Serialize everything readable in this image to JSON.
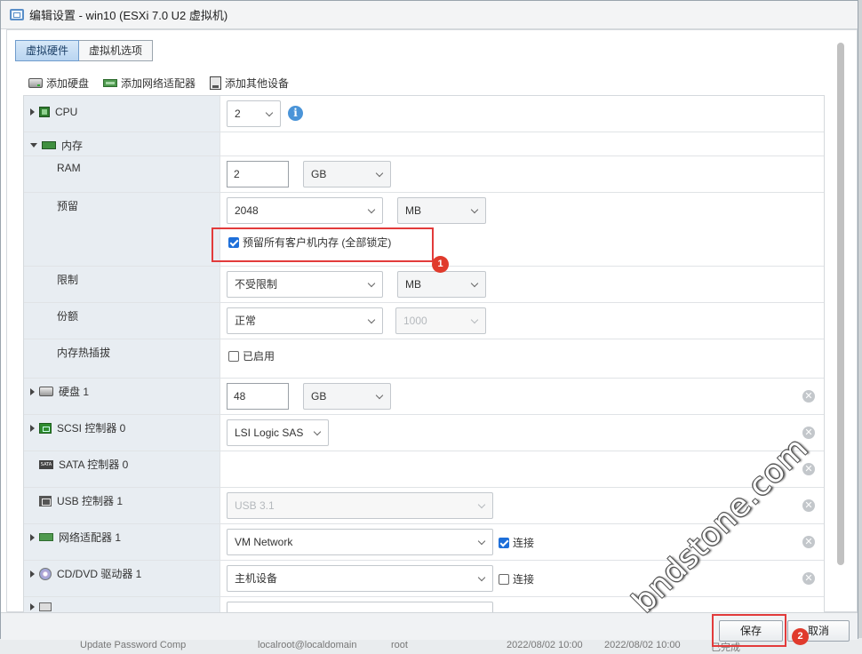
{
  "window": {
    "title": "编辑设置 - win10 (ESXi 7.0 U2 虚拟机)"
  },
  "tabs": [
    {
      "label": "虚拟硬件",
      "active": true
    },
    {
      "label": "虚拟机选项",
      "active": false
    }
  ],
  "toolbar": {
    "add_disk": "添加硬盘",
    "add_nic": "添加网络适配器",
    "add_other": "添加其他设备"
  },
  "hardware": {
    "cpu": {
      "label": "CPU",
      "value": "2",
      "icon": "cpu-icon"
    },
    "memory": {
      "label": "内存",
      "ram_label": "RAM",
      "ram_value": "2",
      "ram_unit": "GB",
      "reservation_label": "预留",
      "reservation_value": "2048",
      "reservation_unit": "MB",
      "reserve_all_label": "预留所有客户机内存 (全部锁定)",
      "reserve_all_checked": true,
      "limit_label": "限制",
      "limit_value": "不受限制",
      "limit_unit": "MB",
      "shares_label": "份额",
      "shares_value": "正常",
      "shares_number": "1000",
      "hotplug_label": "内存热插拔",
      "hotplug_option": "已启用",
      "hotplug_checked": false
    },
    "hard_disk": {
      "label": "硬盘 1",
      "value": "48",
      "unit": "GB"
    },
    "scsi": {
      "label": "SCSI 控制器 0",
      "value": "LSI Logic SAS"
    },
    "sata": {
      "label": "SATA 控制器 0",
      "icon_text": "SATA"
    },
    "usb": {
      "label": "USB 控制器 1",
      "value": "USB 3.1"
    },
    "nic": {
      "label": "网络适配器 1",
      "value": "VM Network",
      "connect_label": "连接",
      "connected": true
    },
    "cdrom": {
      "label": "CD/DVD 驱动器 1",
      "value": "主机设备",
      "connect_label": "连接",
      "connected": false
    }
  },
  "footer": {
    "save": "保存",
    "cancel": "取消"
  },
  "annotations": {
    "badge_1": "1",
    "badge_2": "2"
  },
  "watermark": "bndstone.com",
  "background_strip": {
    "a": "Update Password Comp",
    "b": "localroot@localdomain",
    "c": "root",
    "d": "2022/08/02 10:00",
    "e": "2022/08/02 10:00",
    "f": "已完成"
  },
  "colors": {
    "accent": "#1e6fd9",
    "highlight": "#e23b3b",
    "badge": "#e03a2c",
    "left_column": "#e8edf2"
  }
}
